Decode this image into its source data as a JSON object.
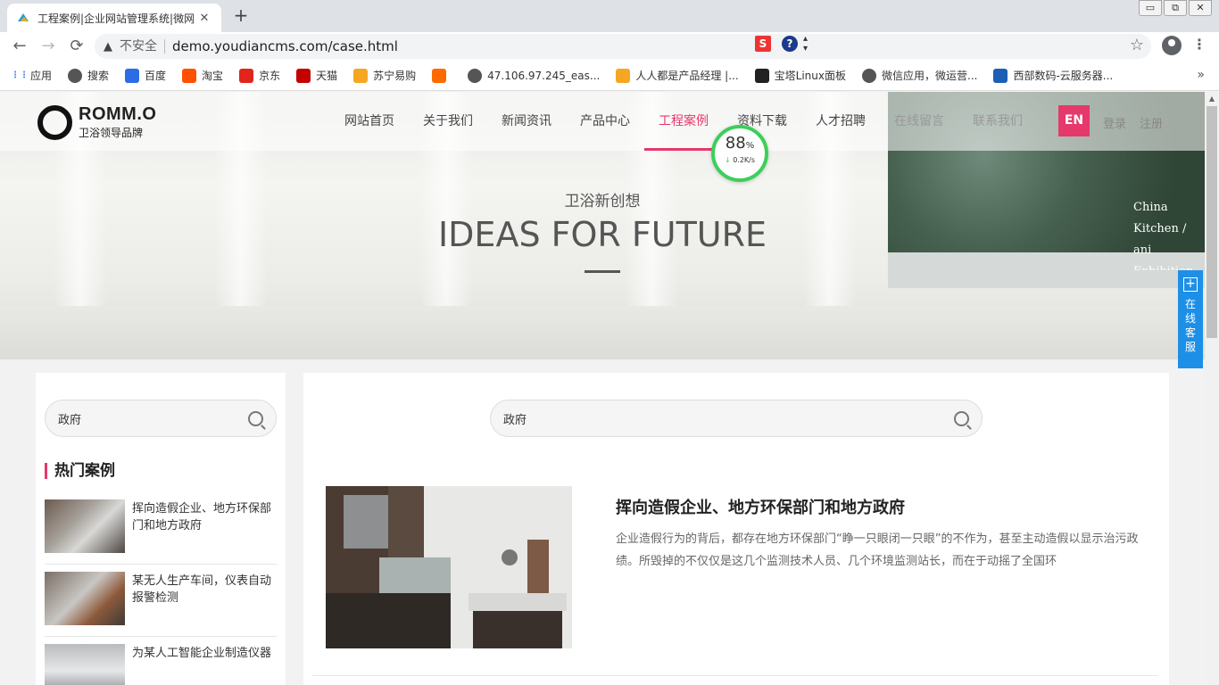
{
  "browser": {
    "tab_title": "工程案例|企业网站管理系统|微网",
    "tab_close": "✕",
    "new_tab": "+",
    "insecure_label": "不安全",
    "url": "demo.youdiancms.com/case.html",
    "window_controls": [
      "▭",
      "⧉",
      "✕"
    ],
    "bookmarks": [
      {
        "label": "应用",
        "icon": "apps-grid-icon",
        "color": "#4285f4"
      },
      {
        "label": "搜索",
        "icon": "globe-icon",
        "color": "#555555"
      },
      {
        "label": "百度",
        "icon": "baidu-paw-icon",
        "color": "#2b6de5"
      },
      {
        "label": "淘宝",
        "icon": "taobao-icon",
        "color": "#ff5000"
      },
      {
        "label": "京东",
        "icon": "jd-icon",
        "color": "#e1251b"
      },
      {
        "label": "天猫",
        "icon": "tmall-icon",
        "color": "#c40000"
      },
      {
        "label": "苏宁易购",
        "icon": "suning-icon",
        "color": "#f5a623"
      },
      {
        "label": "",
        "icon": "aliyun-icon",
        "color": "#ff6a00"
      },
      {
        "label": "47.106.97.245_eas...",
        "icon": "globe-icon",
        "color": "#555555"
      },
      {
        "label": "人人都是产品经理 |...",
        "icon": "woshipm-icon",
        "color": "#f5a623"
      },
      {
        "label": "宝塔Linux面板",
        "icon": "bt-icon",
        "color": "#222222"
      },
      {
        "label": "微信应用，微运营...",
        "icon": "globe-icon",
        "color": "#555555"
      },
      {
        "label": "西部数码-云服务器...",
        "icon": "west-icon",
        "color": "#1e5fb4"
      }
    ],
    "bookmarks_more": "»",
    "ext_s": "S",
    "ext_q": "?"
  },
  "site": {
    "logo_name": "ROMM.O",
    "logo_slogan": "卫浴领导品牌",
    "nav": [
      "网站首页",
      "关于我们",
      "新闻资讯",
      "产品中心",
      "工程案例",
      "资料下载",
      "人才招聘",
      "在线留言",
      "联系我们"
    ],
    "active_nav": 4,
    "lang_button": "EN",
    "login": "登录",
    "register": "注册",
    "accent_color": "#e5386b"
  },
  "speed_widget": {
    "percent": "88",
    "percent_sign": "%",
    "rate": "0.2K/s",
    "arrow": "↓"
  },
  "hero": {
    "subtitle": "卫浴新创想",
    "title": "IDEAS FOR FUTURE",
    "side_text": [
      "China",
      "Kitchen / ani",
      "Exhibition"
    ]
  },
  "side_service": {
    "icon": "+",
    "chars": [
      "在",
      "线",
      "客",
      "服"
    ]
  },
  "sidebar": {
    "search_value": "政府",
    "hot_title": "热门案例",
    "hot_items": [
      {
        "title": "挥向造假企业、地方环保部门和地方政府"
      },
      {
        "title": "某无人生产车间，仪表自动报警检测"
      },
      {
        "title": "为某人工智能企业制造仪器"
      }
    ]
  },
  "main": {
    "search_value": "政府",
    "case": {
      "title": "挥向造假企业、地方环保部门和地方政府",
      "description": "企业造假行为的背后，都存在地方环保部门“睁一只眼闭一只眼”的不作为，甚至主动造假以显示治污政绩。所毁掉的不仅仅是这几个监测技术人员、几个环境监测站长，而在于动摇了全国环"
    }
  }
}
